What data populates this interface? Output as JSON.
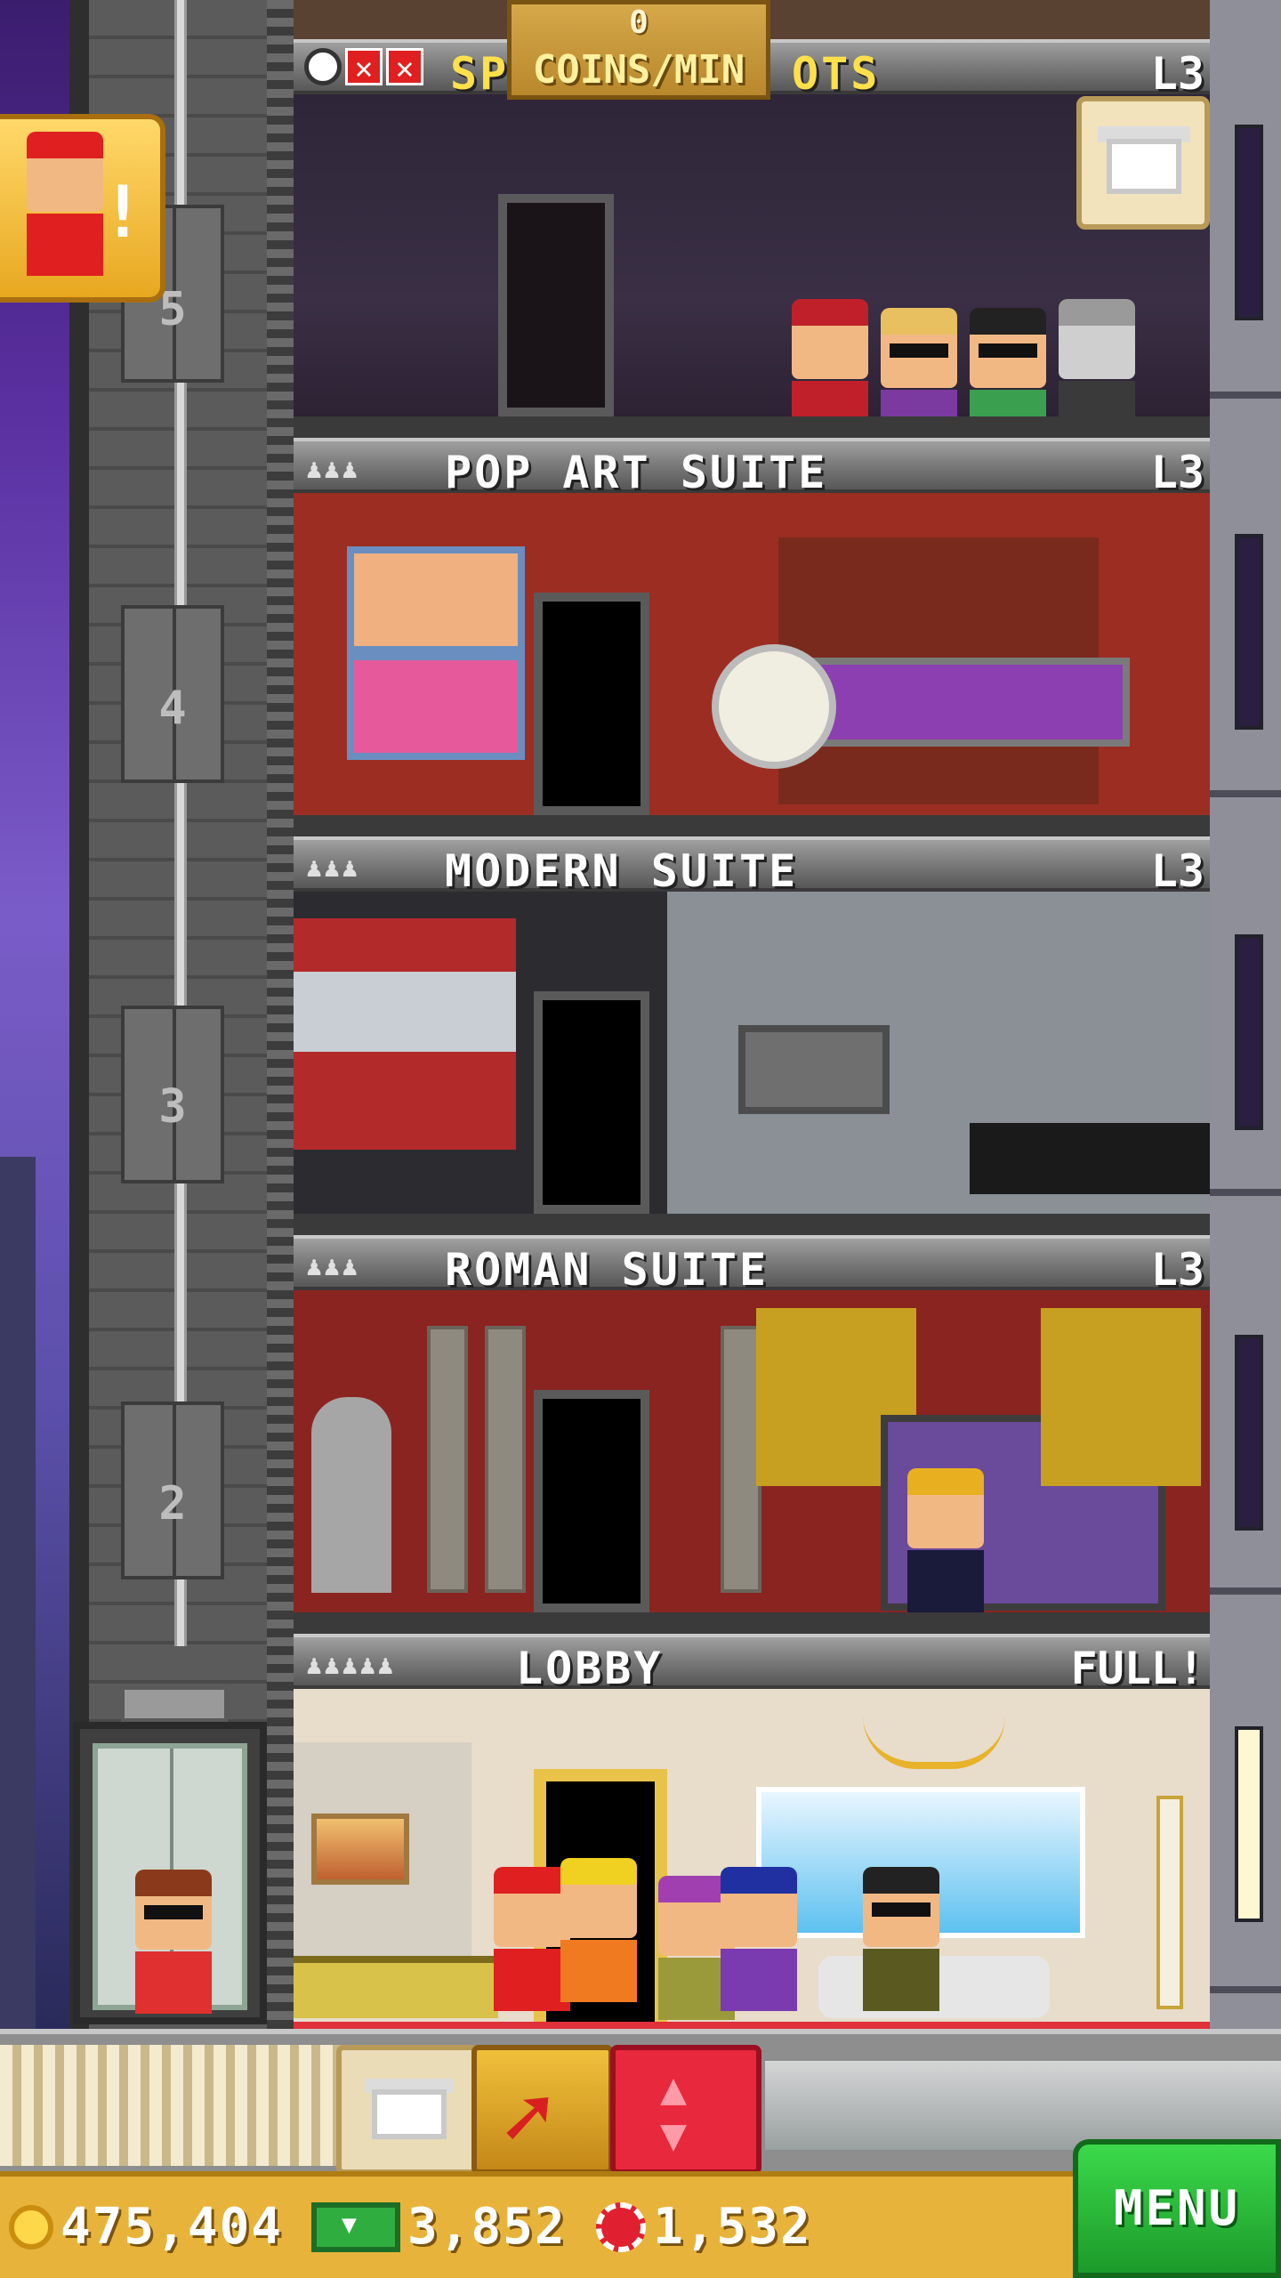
{
  "top_banner": {
    "count": "0",
    "label": "COINS/MIN"
  },
  "floors": [
    {
      "title": "SPA",
      "title_display": "SP",
      "title_tail": "OTS",
      "level": "L3",
      "occupants": "",
      "notice": ""
    },
    {
      "title": "POP ART SUITE",
      "level": "L3",
      "occupants": "♟♟♟"
    },
    {
      "title": "MODERN SUITE",
      "level": "L3",
      "occupants": "♟♟♟"
    },
    {
      "title": "ROMAN SUITE",
      "level": "L3",
      "occupants": "♟♟♟"
    },
    {
      "title": "LOBBY",
      "level": "FULL!",
      "occupants": "♟♟♟♟♟"
    }
  ],
  "shaft_floor_numbers": [
    "5",
    "4",
    "3",
    "2"
  ],
  "bellhop_notice": {
    "mark": "!"
  },
  "status": {
    "coins": "475,404",
    "bux": "3,852",
    "chips": "1,532"
  },
  "menu": {
    "label": "MENU"
  },
  "icons": {
    "clock": "clock-icon",
    "x_marks": [
      "x-icon",
      "x-icon"
    ],
    "coin": "coin-icon",
    "bux": "tower-bux-icon",
    "chip": "casino-chip-icon"
  },
  "colors": {
    "gold": "#e8b33a",
    "menu_green": "#2fbe3c",
    "elevator_red": "#e8283c",
    "spa_title": "#ffe04a"
  }
}
